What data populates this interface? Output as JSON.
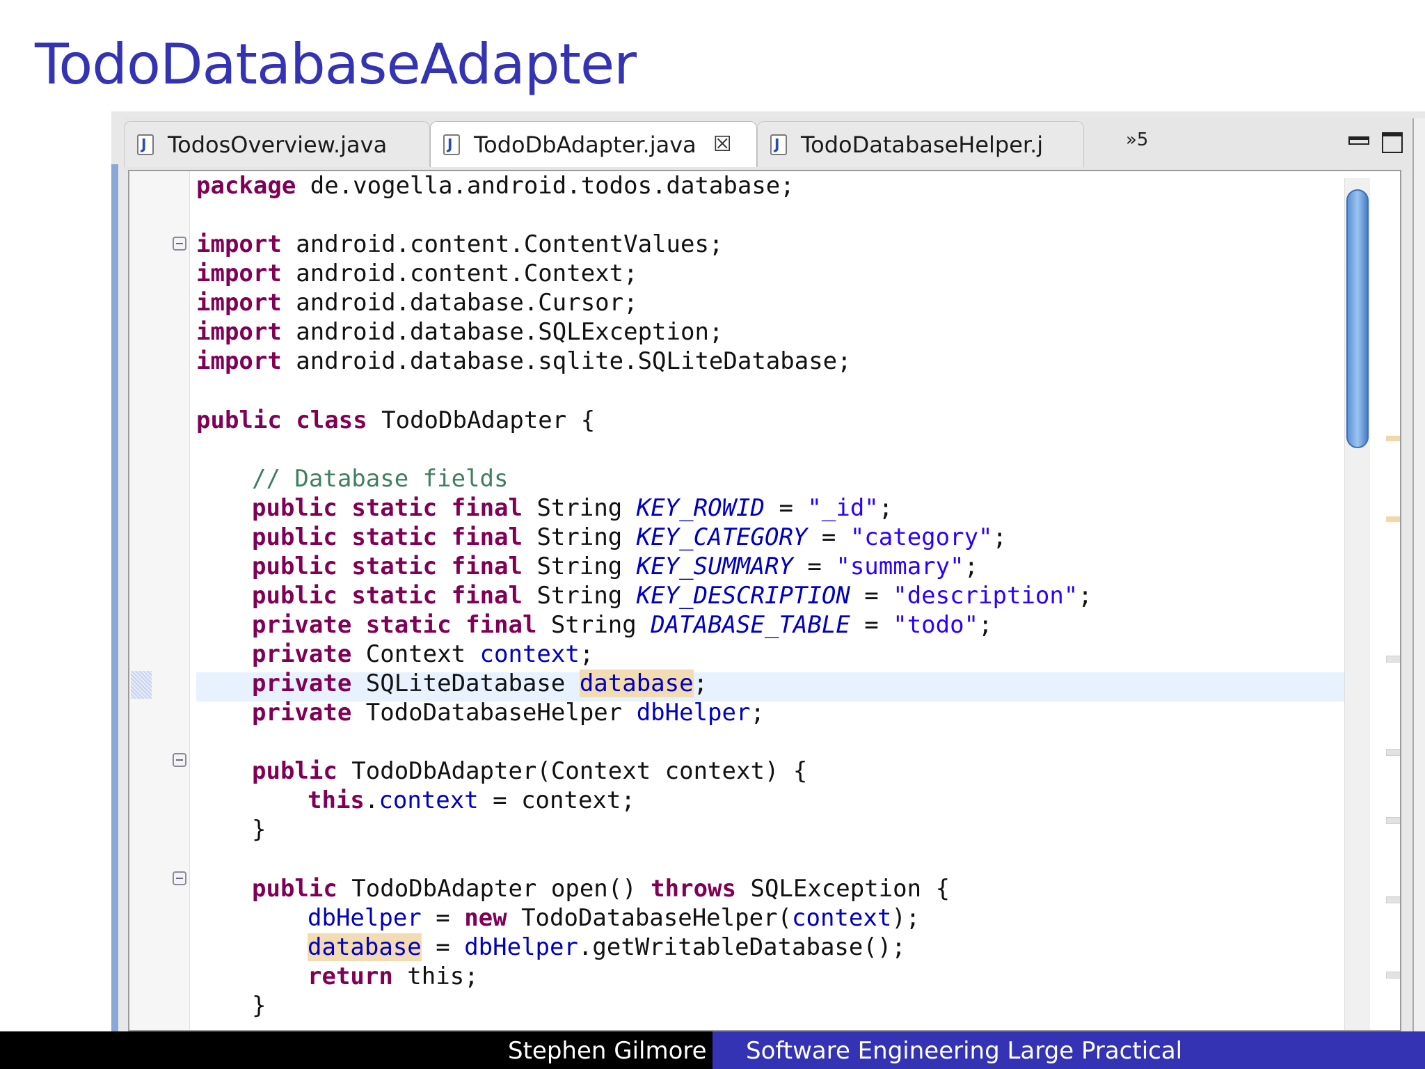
{
  "slide": {
    "title": "TodoDatabaseAdapter",
    "footer_author": "Stephen Gilmore",
    "footer_course": "Software Engineering Large Practical"
  },
  "editor": {
    "tabs": [
      {
        "label": "TodosOverview.java",
        "active": false,
        "icon": "java-file-icon"
      },
      {
        "label": "TodoDbAdapter.java",
        "active": true,
        "icon": "java-file-icon"
      },
      {
        "label": "TodoDatabaseHelper.j",
        "active": false,
        "icon": "java-file-icon"
      }
    ],
    "close_glyph": "☒",
    "overflow_label": "»5",
    "code": {
      "package": "package",
      "package_name": " de.vogella.android.todos.database;",
      "import_kw": "import",
      "imports": [
        " android.content.ContentValues;",
        " android.content.Context;",
        " android.database.Cursor;",
        " android.database.SQLException;",
        " android.database.sqlite.SQLiteDatabase;"
      ],
      "public": "public",
      "class": "class",
      "class_decl": " TodoDbAdapter {",
      "comment": "// Database fields",
      "static": "static",
      "final": "final",
      "private": "private",
      "string_type": " String ",
      "key_rowid": "KEY_ROWID",
      "key_rowid_val": "\"_id\"",
      "key_category": "KEY_CATEGORY",
      "key_category_val": "\"category\"",
      "key_summary": "KEY_SUMMARY",
      "key_summary_val": "\"summary\"",
      "key_description": "KEY_DESCRIPTION",
      "key_description_val": "\"description\"",
      "database_table": "DATABASE_TABLE",
      "database_table_val": "\"todo\"",
      "assign": " = ",
      "semi": ";",
      "context_type": " Context ",
      "context_field": "context",
      "sqlite_type": " SQLiteDatabase ",
      "database_field": "database",
      "helper_type": " TodoDatabaseHelper ",
      "dbhelper_field": "dbHelper",
      "ctor_decl": " TodoDbAdapter(Context context) {",
      "this_kw": "this",
      "dot": ".",
      "ctor_rhs": " = context;",
      "close_brace": "}",
      "open_sig1": " TodoDbAdapter open() ",
      "throws_kw": "throws",
      "open_sig2": " SQLException {",
      "new_kw": "new",
      "new_rhs": " TodoDatabaseHelper(",
      "new_end": ");",
      "getwritable": ".getWritableDatabase();",
      "return_kw": "return",
      "return_rhs": " this;",
      "space": " "
    }
  }
}
